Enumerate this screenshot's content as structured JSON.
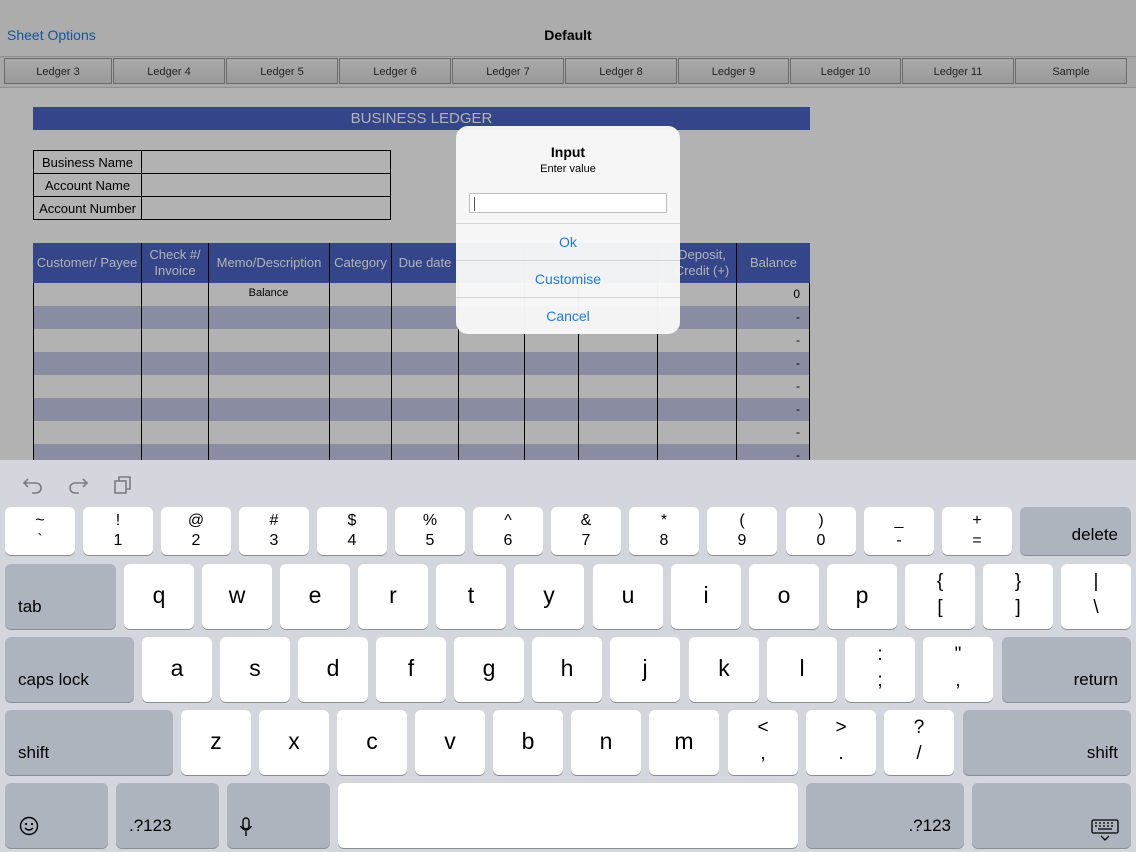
{
  "nav": {
    "sheet_options": "Sheet Options",
    "title": "Default"
  },
  "tabs": [
    "Ledger 3",
    "Ledger 4",
    "Ledger 5",
    "Ledger 6",
    "Ledger 7",
    "Ledger 8",
    "Ledger 9",
    "Ledger 10",
    "Ledger 11",
    "Sample"
  ],
  "ledger": {
    "banner": "BUSINESS LEDGER",
    "info_labels": [
      "Business Name",
      "Account Name",
      "Account Number"
    ],
    "headers": [
      "Customer/ Payee",
      "Check #/ Invoice",
      "Memo/Description",
      "Category",
      "Due date",
      "",
      "",
      "",
      "Deposit, Credit (+)",
      "Balance"
    ],
    "first_row_memo": "Balance",
    "balances": [
      "0",
      "-",
      "-",
      "-",
      "-",
      "-",
      "-",
      "-"
    ]
  },
  "alert": {
    "title": "Input",
    "message": "Enter value",
    "input_value": "",
    "buttons": {
      "ok": "Ok",
      "customise": "Customise",
      "cancel": "Cancel"
    }
  },
  "keyboard": {
    "assistant_icons": [
      "undo-icon",
      "redo-icon",
      "paste-icon"
    ],
    "number_row": [
      {
        "top": "~",
        "bottom": "`"
      },
      {
        "top": "!",
        "bottom": "1"
      },
      {
        "top": "@",
        "bottom": "2"
      },
      {
        "top": "#",
        "bottom": "3"
      },
      {
        "top": "$",
        "bottom": "4"
      },
      {
        "top": "%",
        "bottom": "5"
      },
      {
        "top": "^",
        "bottom": "6"
      },
      {
        "top": "&",
        "bottom": "7"
      },
      {
        "top": "*",
        "bottom": "8"
      },
      {
        "top": "(",
        "bottom": "9"
      },
      {
        "top": ")",
        "bottom": "0"
      },
      {
        "top": "_",
        "bottom": "-"
      },
      {
        "top": "+",
        "bottom": "="
      }
    ],
    "delete": "delete",
    "tab": "tab",
    "row_q": [
      "q",
      "w",
      "e",
      "r",
      "t",
      "y",
      "u",
      "i",
      "o",
      "p"
    ],
    "row_q_symbols": [
      {
        "top": "{",
        "bottom": "["
      },
      {
        "top": "}",
        "bottom": "]"
      },
      {
        "top": "|",
        "bottom": "\\"
      }
    ],
    "caps_lock": "caps lock",
    "row_a": [
      "a",
      "s",
      "d",
      "f",
      "g",
      "h",
      "j",
      "k",
      "l"
    ],
    "row_a_symbols": [
      {
        "top": ":",
        "bottom": ";"
      },
      {
        "top": "\"",
        "bottom": ","
      }
    ],
    "return": "return",
    "shift": "shift",
    "row_z": [
      "z",
      "x",
      "c",
      "v",
      "b",
      "n",
      "m"
    ],
    "row_z_symbols": [
      {
        "top": "<",
        "bottom": ","
      },
      {
        "top": ">",
        "bottom": "."
      },
      {
        "top": "?",
        "bottom": "/"
      }
    ],
    "numbers_label": ".?123",
    "bottom_icons": [
      "emoji-icon",
      "microphone-icon",
      "keyboard-dismiss-icon"
    ]
  }
}
